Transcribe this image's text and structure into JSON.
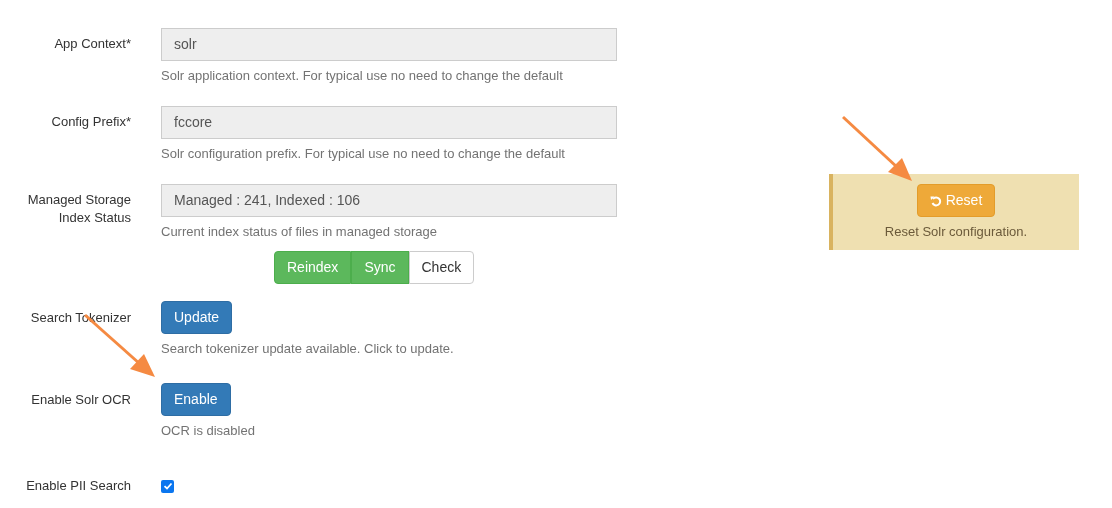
{
  "form": {
    "rows": [
      {
        "kind": "input",
        "label": "App Context*",
        "value": "solr",
        "help": "Solr application context. For typical use no need to change the default"
      },
      {
        "kind": "input",
        "label": "Config Prefix*",
        "value": "fccore",
        "help": "Solr configuration prefix. For typical use no need to change the default"
      },
      {
        "kind": "input",
        "label": "Managed Storage Index Status",
        "value": "Managed : 241, Indexed : 106",
        "help": "Current index status of files in managed storage",
        "buttons": [
          {
            "label": "Reindex",
            "kind": "success"
          },
          {
            "label": "Sync",
            "kind": "success"
          },
          {
            "label": "Check",
            "kind": "default"
          }
        ]
      },
      {
        "kind": "button",
        "label": "Search Tokenizer",
        "button": "Update",
        "help": "Search tokenizer update available. Click to update."
      },
      {
        "kind": "button",
        "label": "Enable Solr OCR",
        "button": "Enable",
        "help": "OCR is disabled"
      },
      {
        "kind": "checkbox",
        "label": "Enable PII Search",
        "checked": true
      }
    ]
  },
  "reset_panel": {
    "button": "Reset",
    "help": "Reset Solr configuration."
  }
}
